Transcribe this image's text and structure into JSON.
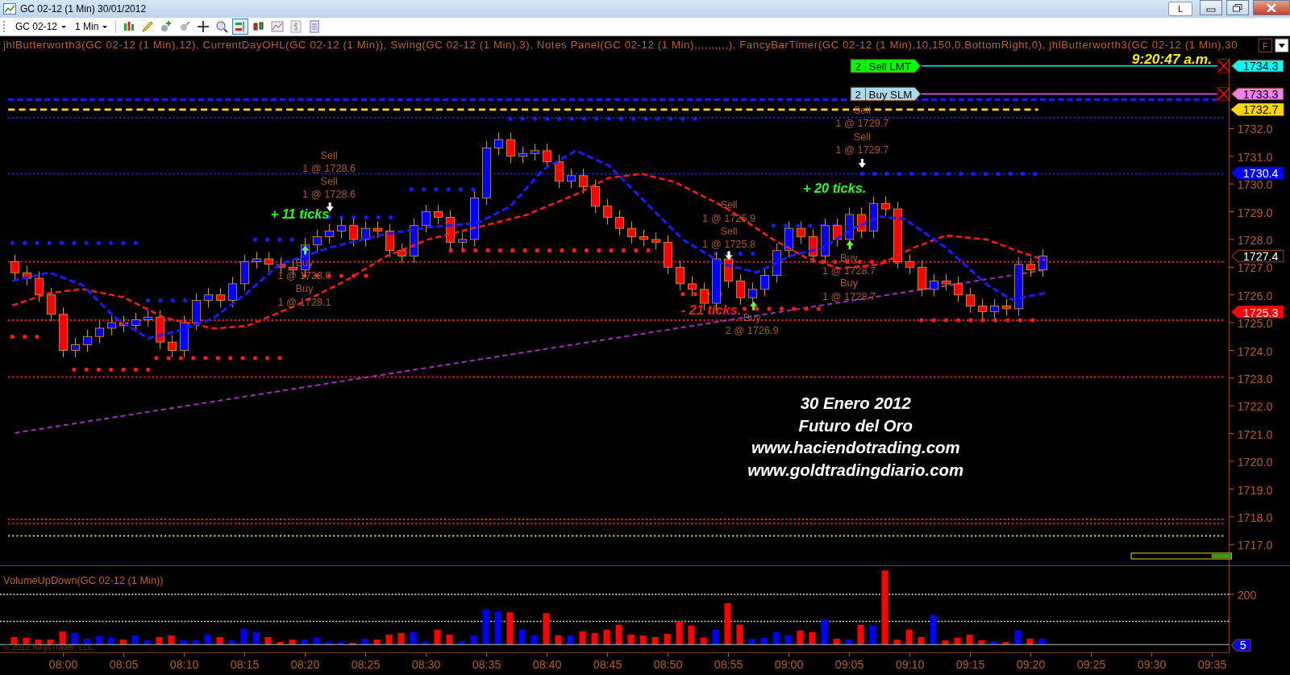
{
  "window": {
    "title": "GC 02-12 (1 Min)  30/01/2012",
    "layout_button": "L"
  },
  "toolbar": {
    "instrument": "GC 02-12",
    "interval": "1 Min",
    "tools": [
      {
        "kind": "bars",
        "selected": false
      },
      {
        "kind": "pencil",
        "selected": false
      },
      {
        "kind": "pin-add",
        "selected": false
      },
      {
        "kind": "pin",
        "selected": false
      },
      {
        "kind": "crosshair",
        "selected": false
      },
      {
        "kind": "zoom",
        "selected": false
      },
      {
        "kind": "chart-trader",
        "selected": true
      },
      {
        "kind": "candles",
        "selected": false
      },
      {
        "kind": "line-chart",
        "selected": false
      },
      {
        "kind": "dollar",
        "selected": false
      },
      {
        "kind": "properties",
        "selected": false
      }
    ]
  },
  "indicators_label": "jhlButterworth3(GC 02-12 (1 Min),12), CurrentDayOHL(GC 02-12 (1 Min)), Swing(GC 02-12 (1 Min),3), Notes Panel(GC 02-12 (1 Min),,,,,,,,,,), FancyBarTimer(GC 02-12 (1 Min),10,150,0,BottomRight,0), jhlButterworth3(GC 02-12 (1 Min),30",
  "panel_button": "F",
  "clock": "9:20:47 a.m.",
  "orders": [
    {
      "qty": "2",
      "label": "Sell LMT",
      "price": "1734.3",
      "kind": "sell"
    },
    {
      "qty": "2",
      "label": "Buy SLM",
      "price": "1733.3",
      "kind": "buy"
    }
  ],
  "price_markers": [
    {
      "price": "1732.7",
      "color": "#ffd700"
    },
    {
      "price": "1730.4",
      "color": "#0000ff"
    },
    {
      "price": "1727.4",
      "color": "#000000"
    },
    {
      "price": "1725.3",
      "color": "#ff0000"
    }
  ],
  "price_axis": [
    "1732.0",
    "1731.0",
    "1730.0",
    "1729.0",
    "1728.0",
    "1727.0",
    "1726.0",
    "1725.0",
    "1724.0",
    "1723.0",
    "1722.0",
    "1721.0",
    "1720.0",
    "1719.0",
    "1718.0",
    "1717.0"
  ],
  "trade_labels": [
    {
      "action": "Sell",
      "fill": "1 @ 1728.6"
    },
    {
      "action": "Sell",
      "fill": "1 @ 1728.6"
    },
    {
      "action": "Buy",
      "fill": "1 @ 1728.0"
    },
    {
      "action": "Buy",
      "fill": "1 @ 1728.1"
    },
    {
      "action": "Sell",
      "fill": "1 @ 1725.9"
    },
    {
      "action": "Sell",
      "fill": "1 @ 1725.8"
    },
    {
      "action": "Buy",
      "fill": "2 @ 1726.9"
    },
    {
      "action": "Sell",
      "fill": "1 @ 1729.7"
    },
    {
      "action": "Sell",
      "fill": "1 @ 1729.7"
    },
    {
      "action": "Buy",
      "fill": "1 @ 1728.7"
    },
    {
      "action": "Buy",
      "fill": "1 @ 1728.7"
    }
  ],
  "tick_notes": [
    {
      "text": "+ 11 ticks",
      "color": "#22ff22"
    },
    {
      "text": "- 21 ticks.",
      "color": "#ff1a1a"
    },
    {
      "text": "+ 20 ticks.",
      "color": "#22ff22"
    }
  ],
  "chart_notes": [
    "30 Enero 2012",
    "Futuro del Oro",
    "www.haciendotrading.com",
    "www.goldtradingdiario.com"
  ],
  "bar_timer": {
    "level": 0.2
  },
  "volume_pane": {
    "title": "VolumeUpDown(GC 02-12 (1 Min))",
    "axis_label": "200",
    "last_value": "5",
    "copyright": "© 2012 NinjaTrader, LLC"
  },
  "time_axis": [
    "08:00",
    "08:05",
    "08:10",
    "08:15",
    "08:20",
    "08:25",
    "08:30",
    "08:35",
    "08:40",
    "08:45",
    "08:50",
    "08:55",
    "09:00",
    "09:05",
    "09:10",
    "09:15",
    "09:20",
    "09:25",
    "09:30",
    "09:35"
  ]
}
